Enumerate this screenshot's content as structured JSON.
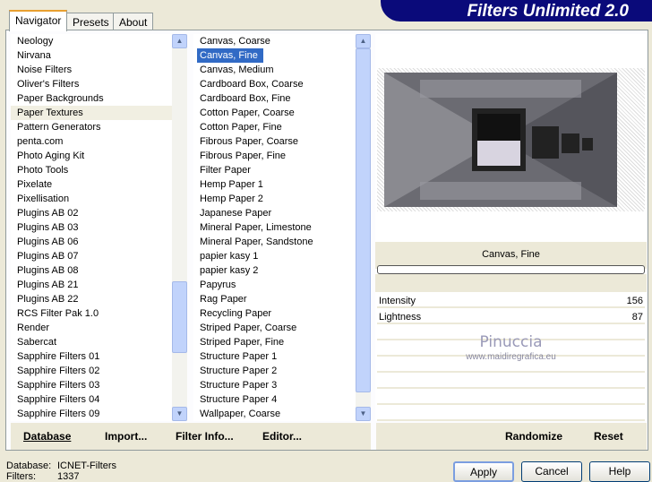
{
  "title": "Filters Unlimited 2.0",
  "tabs": [
    {
      "label": "Navigator"
    },
    {
      "label": "Presets"
    },
    {
      "label": "About"
    }
  ],
  "categories": [
    "Neology",
    "Nirvana",
    "Noise Filters",
    "Oliver's Filters",
    "Paper Backgrounds",
    "Paper Textures",
    "Pattern Generators",
    "penta.com",
    "Photo Aging Kit",
    "Photo Tools",
    "Pixelate",
    "Pixellisation",
    "Plugins AB 02",
    "Plugins AB 03",
    "Plugins AB 06",
    "Plugins AB 07",
    "Plugins AB 08",
    "Plugins AB 21",
    "Plugins AB 22",
    "RCS Filter Pak 1.0",
    "Render",
    "Sabercat",
    "Sapphire Filters 01",
    "Sapphire Filters 02",
    "Sapphire Filters 03",
    "Sapphire Filters 04",
    "Sapphire Filters 09"
  ],
  "selected_category": "Paper Textures",
  "filters": [
    "Canvas, Coarse",
    "Canvas, Fine",
    "Canvas, Medium",
    "Cardboard Box, Coarse",
    "Cardboard Box, Fine",
    "Cotton Paper, Coarse",
    "Cotton Paper, Fine",
    "Fibrous Paper, Coarse",
    "Fibrous Paper, Fine",
    "Filter Paper",
    "Hemp Paper 1",
    "Hemp Paper 2",
    "Japanese Paper",
    "Mineral Paper, Limestone",
    "Mineral Paper, Sandstone",
    "papier kasy 1",
    "papier kasy 2",
    "Papyrus",
    "Rag Paper",
    "Recycling Paper",
    "Striped Paper, Coarse",
    "Striped Paper, Fine",
    "Structure Paper 1",
    "Structure Paper 2",
    "Structure Paper 3",
    "Structure Paper 4",
    "Wallpaper, Coarse"
  ],
  "selected_filter": "Canvas, Fine",
  "filter_name": "Canvas, Fine",
  "params": [
    {
      "label": "Intensity",
      "value": "156",
      "max": 255
    },
    {
      "label": "Lightness",
      "value": "87",
      "max": 255
    }
  ],
  "watermark": {
    "name": "Pinuccia",
    "url": "www.maidiregrafica.eu"
  },
  "toolbar": {
    "database": "Database",
    "import": "Import...",
    "filter_info": "Filter Info...",
    "editor": "Editor...",
    "randomize": "Randomize",
    "reset": "Reset"
  },
  "status": {
    "database_label": "Database:",
    "database_value": "ICNET-Filters",
    "filters_label": "Filters:",
    "filters_value": "1337"
  },
  "buttons": {
    "apply": "Apply",
    "cancel": "Cancel",
    "help": "Help"
  },
  "colors": {
    "banner": "#0a0a7a",
    "selection": "#316ac5"
  }
}
